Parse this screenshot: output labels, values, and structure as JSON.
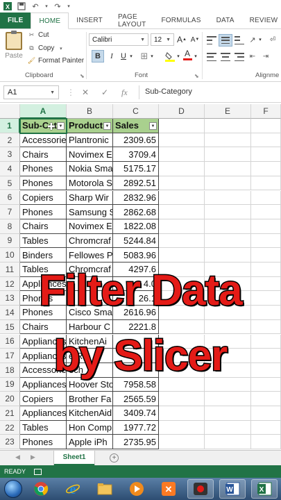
{
  "ribbon": {
    "tabs": [
      "FILE",
      "HOME",
      "INSERT",
      "PAGE LAYOUT",
      "FORMULAS",
      "DATA",
      "REVIEW"
    ],
    "clipboard": {
      "paste_label": "Paste",
      "cut_label": "Cut",
      "copy_label": "Copy",
      "format_painter_label": "Format Painter",
      "group_label": "Clipboard"
    },
    "font": {
      "font_name": "Calibri",
      "font_size": "12",
      "bold": "B",
      "italic": "I",
      "underline": "U",
      "grow": "A",
      "shrink": "A",
      "font_color_glyph": "A",
      "group_label": "Font"
    },
    "alignment": {
      "group_label": "Alignme"
    }
  },
  "formula_bar": {
    "name_box": "A1",
    "cancel": "✕",
    "enter": "✓",
    "fx": "fx",
    "formula": "Sub-Category"
  },
  "grid": {
    "columns": [
      "A",
      "B",
      "C",
      "D",
      "E",
      "F"
    ],
    "headers": [
      "Sub-Cat",
      "Product",
      "Sales"
    ],
    "rows": [
      [
        "Accessories",
        "Plantronic",
        "2309.65"
      ],
      [
        "Chairs",
        "Novimex E",
        "3709.4"
      ],
      [
        "Phones",
        "Nokia Sma",
        "5175.17"
      ],
      [
        "Phones",
        "Motorola S",
        "2892.51"
      ],
      [
        "Copiers",
        "Sharp Wir",
        "2832.96"
      ],
      [
        "Phones",
        "Samsung S",
        "2862.68"
      ],
      [
        "Chairs",
        "Novimex E",
        "1822.08"
      ],
      [
        "Tables",
        "Chromcraf",
        "5244.84"
      ],
      [
        "Binders",
        "Fellowes P",
        "5083.96"
      ],
      [
        "Tables",
        "Chromcraf",
        "4297.6"
      ],
      [
        "Appliances",
        "",
        "4.0"
      ],
      [
        "Phones",
        "",
        "26.1"
      ],
      [
        "Phones",
        "Cisco Sma",
        "2616.96"
      ],
      [
        "Chairs",
        "Harbour C",
        "2221.8"
      ],
      [
        "Appliances",
        "KitchenAi",
        ""
      ],
      [
        "Appliances",
        "e R",
        ""
      ],
      [
        "Accessories",
        "ech",
        ""
      ],
      [
        "Appliances",
        "Hoover Sto",
        "7958.58"
      ],
      [
        "Copiers",
        "Brother Fa",
        "2565.59"
      ],
      [
        "Appliances",
        "KitchenAid",
        "3409.74"
      ],
      [
        "Tables",
        "Hon Comp",
        "1977.72"
      ],
      [
        "Phones",
        "Apple iPh",
        "2735.95"
      ]
    ]
  },
  "overlay": {
    "line1": "Filter Data",
    "line2": "by Slicer"
  },
  "sheets": {
    "active": "Sheet1",
    "add": "+"
  },
  "status": {
    "ready": "READY"
  },
  "colors": {
    "excel_green": "#217346",
    "header_fill": "#a9d08e",
    "overlay_red": "#e41b17"
  }
}
